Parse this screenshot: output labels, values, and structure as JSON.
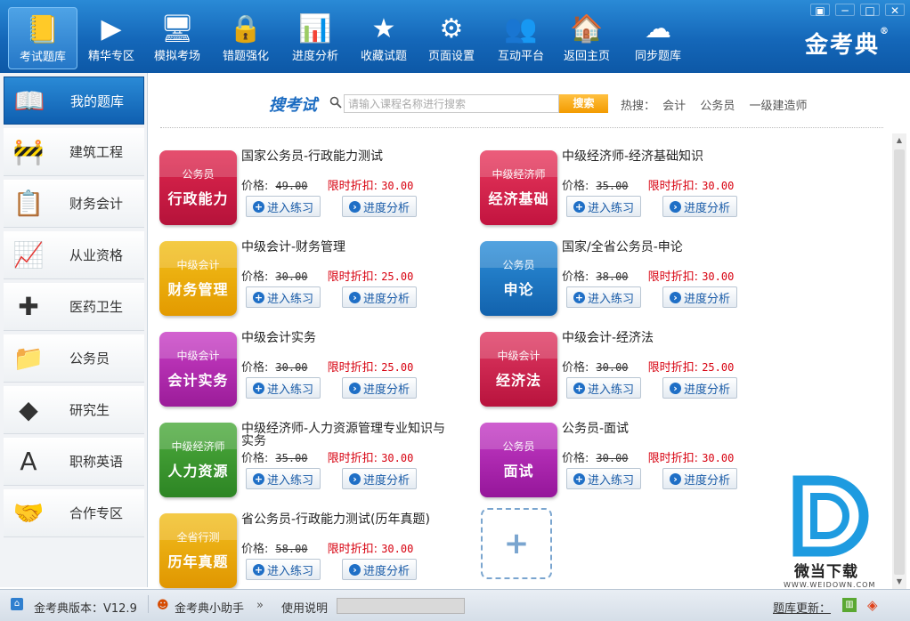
{
  "window": {
    "controls": [
      "▣",
      "─",
      "□",
      "✕"
    ],
    "brand": "金考典",
    "brand_mark": "®"
  },
  "toolbar": [
    {
      "label": "考试题库",
      "icon": "notebook-icon",
      "glyph": "📒",
      "active": true
    },
    {
      "label": "精华专区",
      "icon": "play-circle-icon",
      "glyph": "▶",
      "active": false
    },
    {
      "label": "模拟考场",
      "icon": "monitor-icon",
      "glyph": "🖥",
      "active": false
    },
    {
      "label": "错题强化",
      "icon": "lock-folder-icon",
      "glyph": "🔒",
      "active": false
    },
    {
      "label": "进度分析",
      "icon": "bar-chart-icon",
      "glyph": "📊",
      "active": false
    },
    {
      "label": "收藏试题",
      "icon": "star-icon",
      "glyph": "★",
      "active": false
    },
    {
      "label": "页面设置",
      "icon": "gear-icon",
      "glyph": "⚙",
      "active": false
    },
    {
      "label": "互动平台",
      "icon": "users-icon",
      "glyph": "👥",
      "active": false
    },
    {
      "label": "返回主页",
      "icon": "home-icon",
      "glyph": "🏠",
      "active": false
    },
    {
      "label": "同步题库",
      "icon": "cloud-sync-icon",
      "glyph": "☁",
      "active": false
    }
  ],
  "sidebar": [
    {
      "label": "我的题库",
      "icon": "book-pen-icon",
      "glyph": "📖",
      "active": true
    },
    {
      "label": "建筑工程",
      "icon": "construction-sign-icon",
      "glyph": "🚧",
      "active": false
    },
    {
      "label": "财务会计",
      "icon": "clipboard-chart-icon",
      "glyph": "📋",
      "active": false
    },
    {
      "label": "从业资格",
      "icon": "bar-growth-icon",
      "glyph": "📈",
      "active": false
    },
    {
      "label": "医药卫生",
      "icon": "medical-kit-icon",
      "glyph": "✚",
      "active": false
    },
    {
      "label": "公务员",
      "icon": "document-pen-icon",
      "glyph": "📁",
      "active": false
    },
    {
      "label": "研究生",
      "icon": "layers-icon",
      "glyph": "◆",
      "active": false
    },
    {
      "label": "职称英语",
      "icon": "letter-a-plus-icon",
      "glyph": "A",
      "active": false
    },
    {
      "label": "合作专区",
      "icon": "handshake-icon",
      "glyph": "🤝",
      "active": false
    }
  ],
  "search": {
    "label": "搜考试",
    "placeholder": "请输入课程名称进行搜索",
    "button": "搜索",
    "hot_label": "热搜：",
    "hot_terms": [
      "会计",
      "公务员",
      "一级建造师"
    ]
  },
  "courses": [
    {
      "title": "国家公务员-行政能力测试",
      "tile_top": "公务员",
      "tile_main": "行政能力",
      "color": "#e0284f",
      "color2": "#b5123a",
      "price": "49.00",
      "sale": "30.00"
    },
    {
      "title": "中级经济师-经济基础知识",
      "tile_top": "中级经济师",
      "tile_main": "经济基础",
      "color": "#e83a5e",
      "color2": "#c2133f",
      "price": "35.00",
      "sale": "30.00"
    },
    {
      "title": "中级会计-财务管理",
      "tile_top": "中级会计",
      "tile_main": "财务管理",
      "color": "#f2c01b",
      "color2": "#e39a00",
      "price": "30.00",
      "sale": "25.00"
    },
    {
      "title": "国家/全省公务员-申论",
      "tile_top": "公务员",
      "tile_main": "申论",
      "color": "#2d8fd9",
      "color2": "#1262ad",
      "price": "38.00",
      "sale": "30.00"
    },
    {
      "title": "中级会计实务",
      "tile_top": "中级会计",
      "tile_main": "会计实务",
      "color": "#c93fc6",
      "color2": "#9b1c99",
      "price": "30.00",
      "sale": "25.00"
    },
    {
      "title": "中级会计-经济法",
      "tile_top": "中级会计",
      "tile_main": "经济法",
      "color": "#e03a63",
      "color2": "#b8133d",
      "price": "30.00",
      "sale": "25.00"
    },
    {
      "title": "中级经济师-人力资源管理专业知识与实务",
      "tile_top": "中级经济师",
      "tile_main": "人力资源",
      "color": "#4dab3d",
      "color2": "#2d8524",
      "price": "35.00",
      "sale": "30.00"
    },
    {
      "title": "公务员-面试",
      "tile_top": "公务员",
      "tile_main": "面试",
      "color": "#c53cc6",
      "color2": "#95169a",
      "price": "30.00",
      "sale": "30.00"
    },
    {
      "title": "省公务员-行政能力测试(历年真题)",
      "tile_top": "全省行测",
      "tile_main": "历年真题",
      "color": "#f2bf1f",
      "color2": "#e09600",
      "price": "58.00",
      "sale": "30.00"
    }
  ],
  "course_labels": {
    "price": "价格:",
    "sale": "限时折扣:",
    "practice": "进入练习",
    "progress": "进度分析"
  },
  "add_tile": "+",
  "watermark": {
    "text": "微当下载",
    "url": "WWW.WEIDOWN.COM"
  },
  "statusbar": {
    "version": "金考典版本：V12.9",
    "assistant": "金考典小助手",
    "guide": "使用说明",
    "update": "题库更新："
  }
}
